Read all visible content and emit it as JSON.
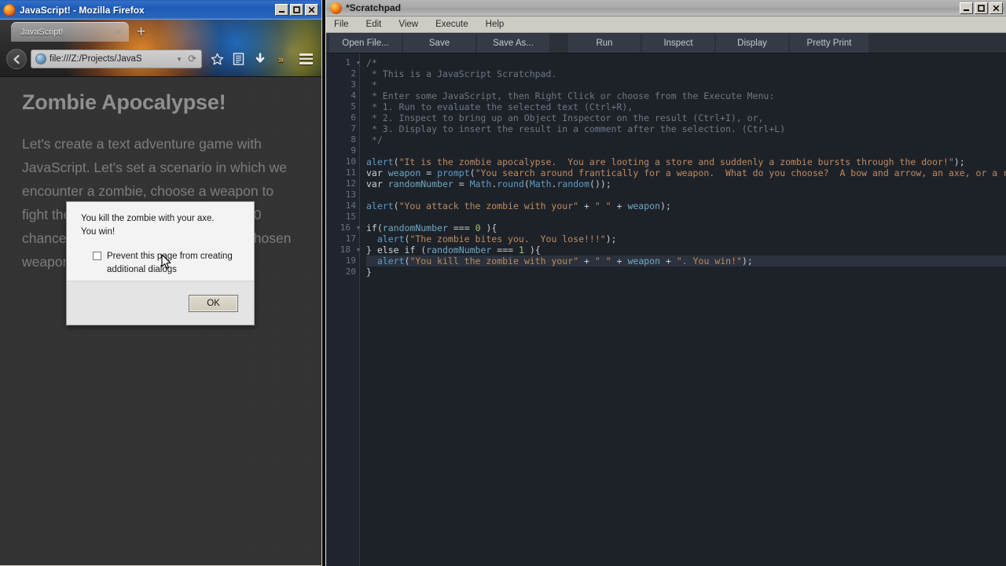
{
  "firefox": {
    "window_title": "JavaScript! - Mozilla Firefox",
    "tab_label": "JavaScript!",
    "tab_close": "×",
    "new_tab": "+",
    "url": "file:///Z:/Projects/JavaS",
    "page": {
      "heading": "Zombie Apocalypse!",
      "paragraph": "Let's create a text adventure game with JavaScript. Let's set a scenario in which we encounter a zombie, choose a weapon to fight the zombie with, and have a 50/50 chance of either defeating it with our chosen weapon or getting eaten."
    },
    "titlebar_buttons": {
      "minimize": "minimize-icon",
      "maximize": "maximize-icon",
      "close": "close-icon"
    }
  },
  "dialog": {
    "message_line1": "You kill the zombie with your axe.",
    "message_line2": "You win!",
    "checkbox_label": "Prevent this page from creating additional dialogs",
    "checkbox_checked": false,
    "ok_label": "OK"
  },
  "scratchpad": {
    "window_title": "*Scratchpad",
    "menu": [
      {
        "pre": "",
        "accel": "F",
        "post": "ile"
      },
      {
        "pre": "",
        "accel": "E",
        "post": "dit"
      },
      {
        "pre": "",
        "accel": "V",
        "post": "iew"
      },
      {
        "pre": "E",
        "accel": "x",
        "post": "ecute"
      },
      {
        "pre": "",
        "accel": "H",
        "post": "elp"
      }
    ],
    "menu_labels": [
      "File",
      "Edit",
      "View",
      "Execute",
      "Help"
    ],
    "toolbar": [
      "Open File...",
      "Save",
      "Save As...",
      "Run",
      "Inspect",
      "Display",
      "Pretty Print"
    ],
    "line_numbers": [
      "1",
      "2",
      "3",
      "4",
      "5",
      "6",
      "7",
      "8",
      "9",
      "10",
      "11",
      "12",
      "13",
      "14",
      "15",
      "16",
      "17",
      "18",
      "19",
      "20"
    ],
    "fold_lines": [
      1,
      16,
      18
    ],
    "highlighted_line": 19,
    "code_lines": [
      "/*",
      " * This is a JavaScript Scratchpad.",
      " *",
      " * Enter some JavaScript, then Right Click or choose from the Execute Menu:",
      " * 1. Run to evaluate the selected text (Ctrl+R),",
      " * 2. Inspect to bring up an Object Inspector on the result (Ctrl+I), or,",
      " * 3. Display to insert the result in a comment after the selection. (Ctrl+L)",
      " */",
      "",
      "alert(\"It is the zombie apocalypse.  You are looting a store and suddenly a zombie bursts through the door!\");",
      "var weapon = prompt(\"You search around frantically for a weapon.  What do you choose?  A bow and arrow, an axe, or a rubber chicken?\");",
      "var randomNumber = Math.round(Math.random());",
      "",
      "alert(\"You attack the zombie with your\" + \" \" + weapon);",
      "",
      "if(randomNumber === 0 ){",
      "  alert(\"The zombie bites you.  You lose!!!\");",
      "} else if (randomNumber === 1 ){",
      "  alert(\"You kill the zombie with your\" + \" \" + weapon + \". You win!\");",
      "}"
    ],
    "titlebar_buttons": {
      "minimize": "minimize-icon",
      "maximize": "maximize-icon",
      "close": "close-icon"
    }
  },
  "colors": {
    "firefox_titlebar": "#2a5db0",
    "scratchpad_editor_bg": "#1d2229",
    "code_string": "#c08a5e",
    "code_function": "#5b9ec9",
    "code_variable": "#6ea8c4",
    "code_comment": "#6f7783",
    "code_number": "#a8c46a",
    "highlight_line_bg": "#2b323d"
  }
}
